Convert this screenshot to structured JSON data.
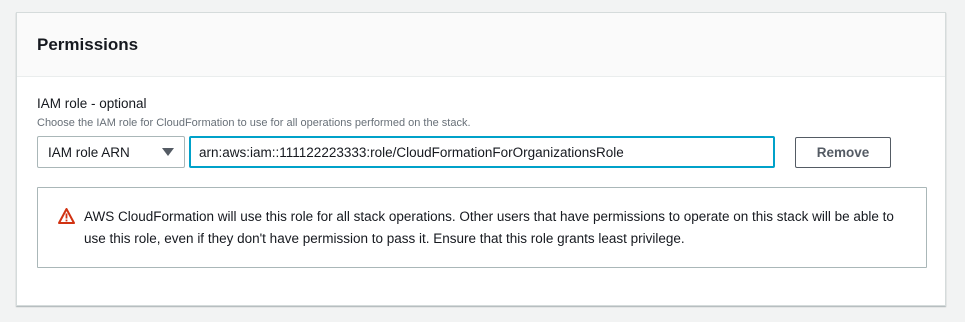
{
  "panel": {
    "title": "Permissions"
  },
  "iam_role": {
    "label": "IAM role - optional",
    "description": "Choose the IAM role for CloudFormation to use for all operations performed on the stack.",
    "select_value": "IAM role ARN",
    "input_value": "arn:aws:iam::111122223333:role/CloudFormationForOrganizationsRole",
    "remove_label": "Remove"
  },
  "alert": {
    "icon": "warning-triangle-icon",
    "text": "AWS CloudFormation will use this role for all stack operations. Other users that have permissions to operate on this stack will be able to use this role, even if they don't have permission to pass it. Ensure that this role grants least privilege."
  },
  "colors": {
    "focus_border": "#00a1c9",
    "warning": "#d13212",
    "text": "#16191f",
    "muted_text": "#687078"
  }
}
